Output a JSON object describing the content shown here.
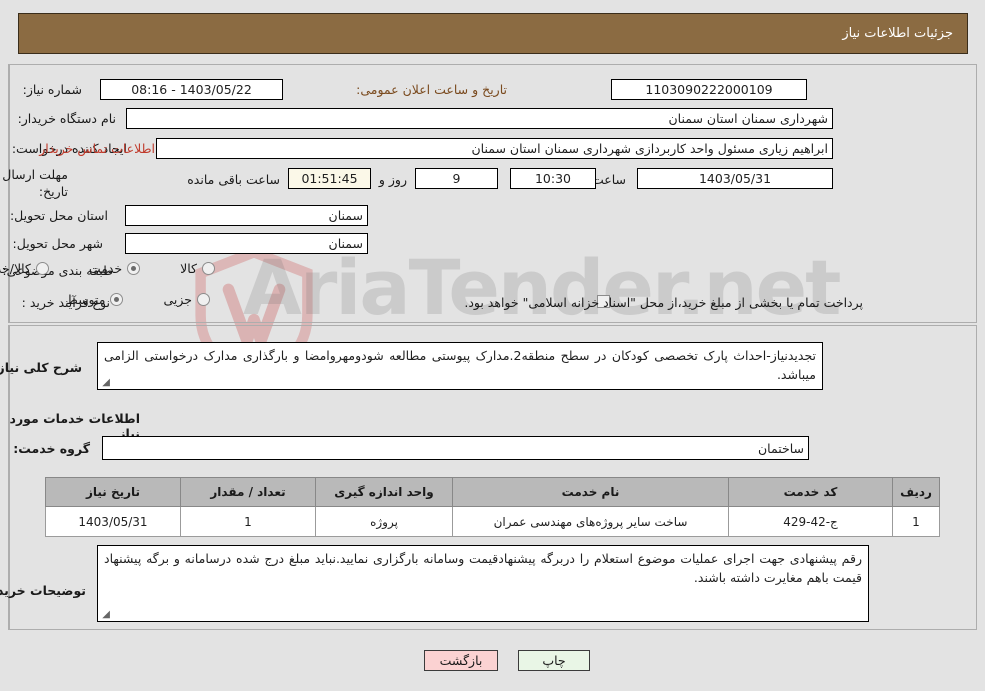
{
  "header": {
    "title": "جزئیات اطلاعات نیاز"
  },
  "watermark": {
    "text": "AriaTender.net",
    "logo": "shield-logo"
  },
  "form": {
    "need_number": {
      "label": "شماره نیاز:",
      "value": "1103090222000109"
    },
    "announce_datetime": {
      "label": "تاریخ و ساعت اعلان عمومی:",
      "value": "1403/05/22 - 08:16"
    },
    "buyer_org": {
      "label": "نام دستگاه خریدار:",
      "value": "شهرداری سمنان استان سمنان"
    },
    "requester": {
      "label": "ایجاد کننده درخواست:",
      "value": "ابراهیم زیاری مسئول واحد کاربردازی شهرداری سمنان استان سمنان"
    },
    "contact_link": {
      "label": "اطلاعات تماس خریدار"
    },
    "deadline": {
      "label": "مهلت ارسال پاسخ: تا تاریخ:",
      "date": "1403/05/31",
      "hour_label": "ساعت",
      "hour": "10:30",
      "empty_field": "",
      "days": "9",
      "days_label": "روز و",
      "remaining": "01:51:45",
      "remaining_label": "ساعت باقی مانده"
    },
    "delivery_province": {
      "label": "استان محل تحویل:",
      "value": "سمنان"
    },
    "delivery_city": {
      "label": "شهر محل تحویل:",
      "value": "سمنان"
    },
    "subject_class": {
      "label": "طبقه بندی موضوعی:",
      "options": [
        {
          "label": "کالا",
          "selected": false
        },
        {
          "label": "خدمت",
          "selected": true
        },
        {
          "label": "کالا/خدمت",
          "selected": false
        }
      ]
    },
    "purchase_process": {
      "label": "نوع فرآیند خرید :",
      "options": [
        {
          "label": "جزیی",
          "selected": false
        },
        {
          "label": "متوسط",
          "selected": true
        }
      ],
      "checkbox_label": "پرداخت تمام یا بخشی از مبلغ خرید،از محل \"اسناد خزانه اسلامی\" خواهد بود.",
      "checkbox_checked": false
    },
    "general_desc": {
      "label": "شرح کلی نیاز:",
      "value": "تجدیدنیاز-احداث پارک تخصصی کودکان در سطح منطقه2.مدارک پیوستی مطالعه شودومهروامضا و بارگذاری مدارک درخواستی الزامی میباشد."
    },
    "services_heading": "اطلاعات خدمات مورد نیاز",
    "service_group": {
      "label": "گروه خدمت:",
      "value": "ساختمان"
    },
    "buyer_notes": {
      "label": "توضیحات خریدار:",
      "value": "رقم پیشنهادی جهت اجرای عملیات موضوع استعلام را دربرگه پیشنهادقیمت وسامانه بارگزاری نمایید.نباید مبلغ درج شده درسامانه و برگه پیشنهاد قیمت باهم مغایرت داشته باشند."
    }
  },
  "table": {
    "columns": [
      "ردیف",
      "کد خدمت",
      "نام خدمت",
      "واحد اندازه گیری",
      "تعداد / مقدار",
      "تاریخ نیاز"
    ],
    "rows": [
      {
        "row": "1",
        "code": "ج-42-429",
        "name": "ساخت سایر پروژه‌های مهندسی عمران",
        "unit": "پروژه",
        "qty": "1",
        "date": "1403/05/31"
      }
    ]
  },
  "footer": {
    "print_label": "چاپ",
    "back_label": "بازگشت"
  },
  "colors": {
    "header_bg": "#8b6b42",
    "page_bg": "#e3e3e3",
    "link": "#c03a2b",
    "brown_label": "#7a4a1e",
    "print_btn": "#e9f6e6",
    "back_btn": "#fbd2d2",
    "timer_bg": "#fbf8e8"
  }
}
